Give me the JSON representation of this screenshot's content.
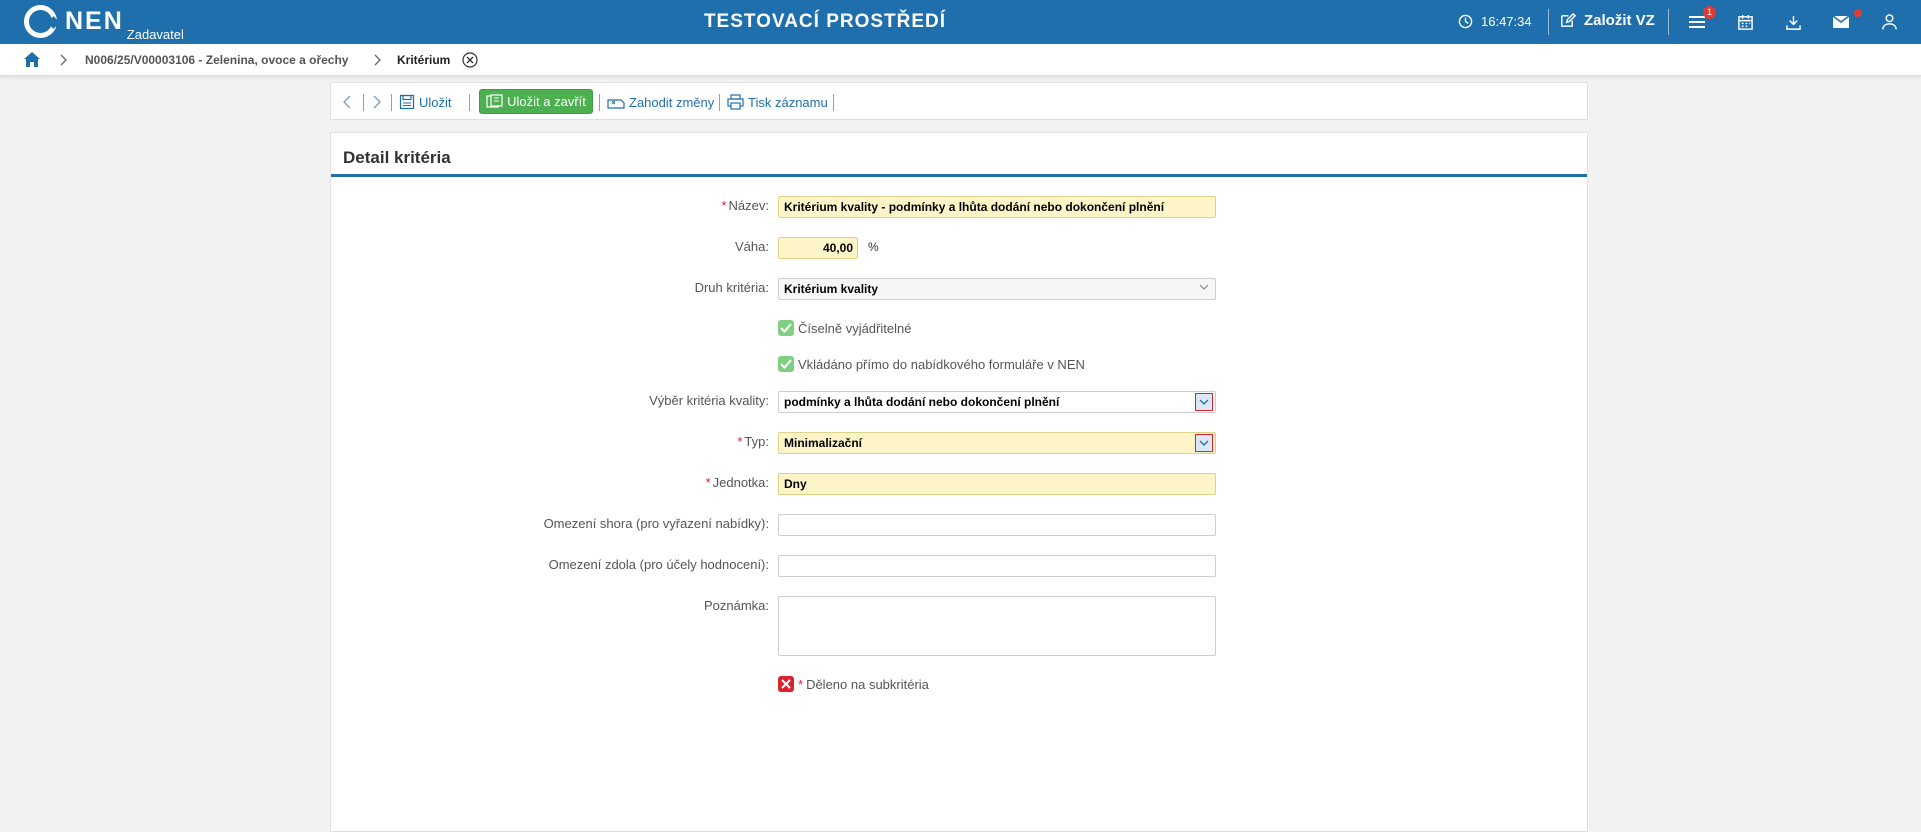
{
  "header": {
    "logo_text": "NEN",
    "logo_sub": "Zadavatel",
    "env_title": "TESTOVACÍ PROSTŘEDÍ",
    "time": "16:47:34",
    "create_label": "Založit VZ",
    "menu_badge": "1",
    "icons": [
      "clock-icon",
      "edit-icon",
      "menu-icon",
      "calendar-icon",
      "download-icon",
      "mail-icon",
      "user-icon"
    ],
    "color": "#1f6fad"
  },
  "breadcrumb": {
    "items": [
      "N006/25/V00003106 - Zelenina, ovoce a ořechy",
      "Kritérium"
    ]
  },
  "toolbar": {
    "save_label": "Uložit",
    "save_close_label": "Uložit a zavřít",
    "discard_label": "Zahodit změny",
    "print_label": "Tisk záznamu"
  },
  "panel": {
    "title": "Detail kritéria"
  },
  "form": {
    "name_label": "Název:",
    "name_value": "Kritérium kvality - podmínky a lhůta dodání nebo dokončení plnění",
    "weight_label": "Váha:",
    "weight_value": "40,00",
    "weight_unit": "%",
    "kind_label": "Druh kritéria:",
    "kind_value": "Kritérium kvality",
    "numeric_label": "Číselně vyjádřitelné",
    "numeric_checked": true,
    "inserted_label": "Vkládáno přímo do nabídkového formuláře v NEN",
    "inserted_checked": true,
    "quality_label": "Výběr kritéria kvality:",
    "quality_value": "podmínky a lhůta dodání nebo dokončení plnění",
    "type_label": "Typ:",
    "type_value": "Minimalizační",
    "unit_label": "Jednotka:",
    "unit_value": "Dny",
    "upper_label": "Omezení shora (pro vyřazení nabídky):",
    "upper_value": "",
    "lower_label": "Omezení zdola (pro účely hodnocení):",
    "lower_value": "",
    "note_label": "Poznámka:",
    "note_value": "",
    "subcrit_label": "Děleno na subkritéria",
    "subcrit_checked": false
  }
}
